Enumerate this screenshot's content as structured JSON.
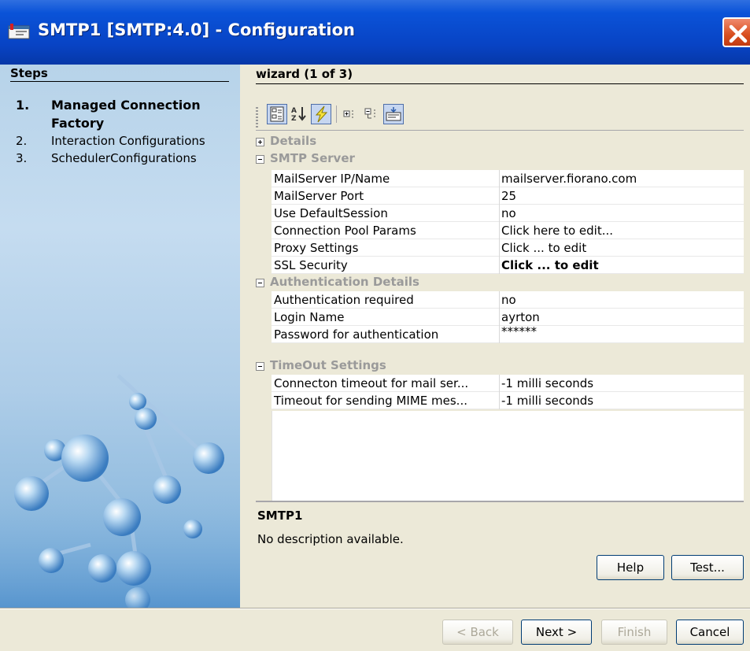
{
  "window": {
    "title": "SMTP1 [SMTP:4.0] - Configuration"
  },
  "steps": {
    "header": "Steps",
    "items": [
      {
        "num": "1.",
        "label": "Managed Connection Factory",
        "active": true
      },
      {
        "num": "2.",
        "label": "Interaction Configurations",
        "active": false
      },
      {
        "num": "3.",
        "label": "SchedulerConfigurations",
        "active": false
      }
    ]
  },
  "wizard": {
    "header": "wizard (1 of 3)"
  },
  "toolbar": {
    "buttons": [
      {
        "icon": "categorized-view-icon",
        "pressed": true
      },
      {
        "icon": "sort-alphabetical-icon",
        "pressed": false
      },
      {
        "icon": "lightning-icon",
        "pressed": true
      },
      {
        "icon": "expand-all-icon",
        "pressed": false
      },
      {
        "icon": "collapse-all-icon",
        "pressed": false
      },
      {
        "icon": "description-toggle-icon",
        "pressed": true
      }
    ]
  },
  "properties": {
    "categories": [
      {
        "label": "Details",
        "expanded": false,
        "rows": []
      },
      {
        "label": "SMTP Server",
        "expanded": true,
        "rows": [
          {
            "name": "MailServer IP/Name",
            "value": "mailserver.fiorano.com"
          },
          {
            "name": "MailServer Port",
            "value": "25"
          },
          {
            "name": "Use DefaultSession",
            "value": "no"
          },
          {
            "name": "Connection Pool Params",
            "value": "Click here to edit..."
          },
          {
            "name": "Proxy Settings",
            "value": "Click ... to edit"
          },
          {
            "name": "SSL Security",
            "value": "Click ... to edit",
            "bold": true
          }
        ]
      },
      {
        "label": "Authentication Details",
        "expanded": true,
        "rows": [
          {
            "name": "Authentication required",
            "value": "no"
          },
          {
            "name": "Login Name",
            "value": "ayrton"
          },
          {
            "name": "Password for authentication",
            "value": "******"
          }
        ]
      },
      {
        "label": "TimeOut Settings",
        "expanded": true,
        "rows": [
          {
            "name": "Connecton timeout for mail ser...",
            "value": "-1  milli seconds"
          },
          {
            "name": "Timeout for sending MIME mes...",
            "value": "-1  milli seconds"
          }
        ]
      }
    ]
  },
  "description": {
    "title": "SMTP1",
    "text": "No description available."
  },
  "buttons": {
    "help": "Help",
    "test": "Test...",
    "back": "< Back",
    "next": "Next >",
    "finish": "Finish",
    "cancel": "Cancel"
  },
  "colors": {
    "titlebar": "#0a53d8",
    "close": "#d84e1e",
    "dialog_bg": "#ece9d8"
  }
}
